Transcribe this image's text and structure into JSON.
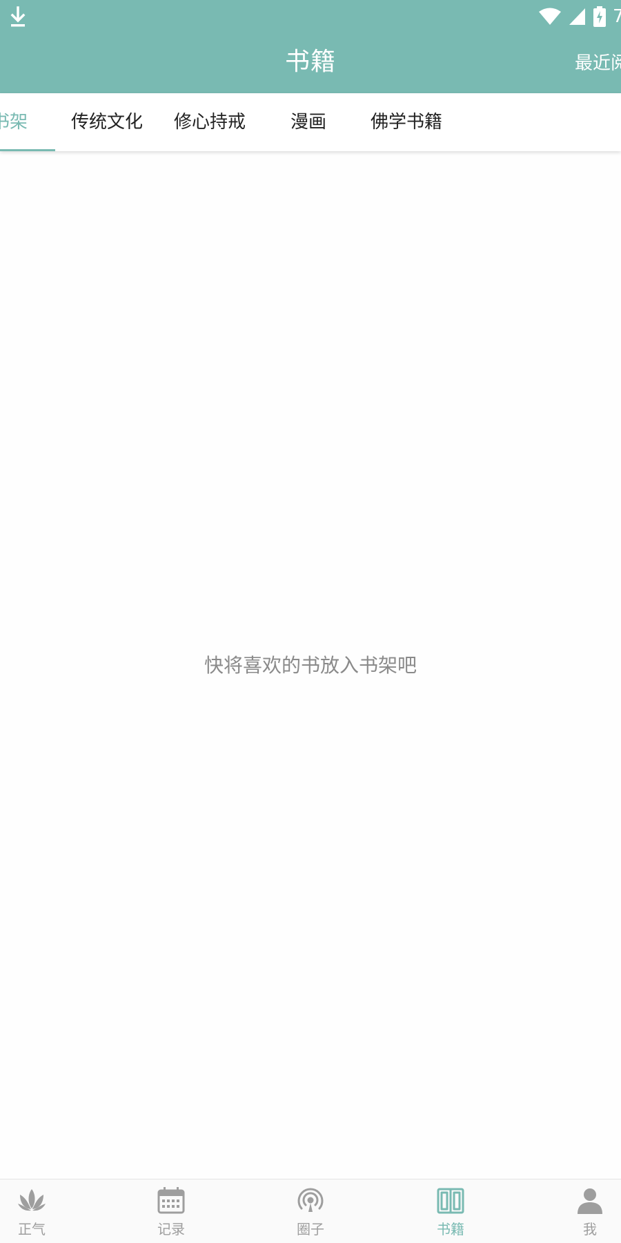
{
  "status_bar": {
    "time": "7",
    "icons": [
      "download-icon",
      "wifi-icon",
      "cellular-signal-icon",
      "battery-charging-icon"
    ]
  },
  "header": {
    "title": "书籍",
    "recent_label": "最近阅"
  },
  "tabs": [
    {
      "label": "书架",
      "active": true
    },
    {
      "label": "传统文化",
      "active": false
    },
    {
      "label": "修心持戒",
      "active": false
    },
    {
      "label": "漫画",
      "active": false
    },
    {
      "label": "佛学书籍",
      "active": false
    }
  ],
  "empty_state": {
    "message": "快将喜欢的书放入书架吧"
  },
  "bottom_nav": [
    {
      "label": "正气",
      "icon": "lotus-icon",
      "active": false
    },
    {
      "label": "记录",
      "icon": "calendar-icon",
      "active": false
    },
    {
      "label": "圈子",
      "icon": "broadcast-icon",
      "active": false
    },
    {
      "label": "书籍",
      "icon": "book-icon",
      "active": true
    },
    {
      "label": "我",
      "icon": "user-icon",
      "active": false
    }
  ],
  "colors": {
    "accent": "#79bab2",
    "inactive_nav": "#9e9e9e",
    "empty_text": "#8a8a8a"
  }
}
